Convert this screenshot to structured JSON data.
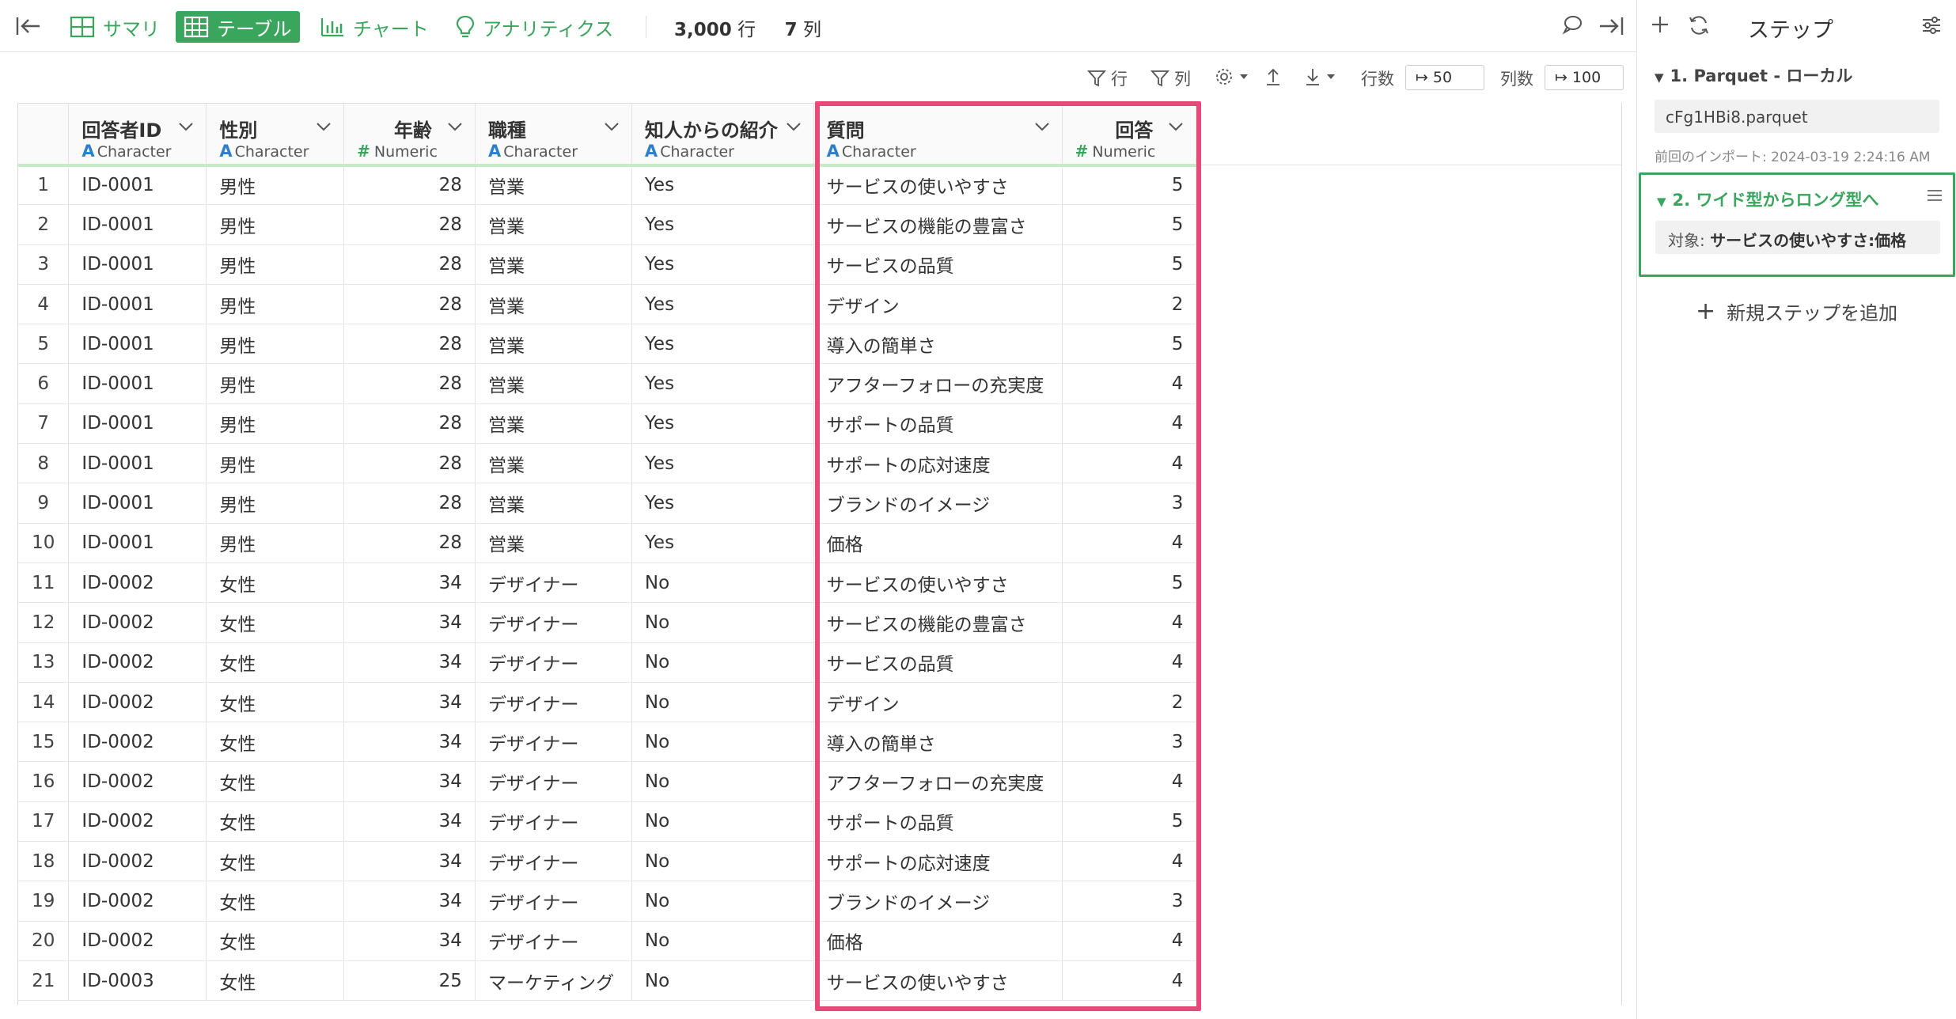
{
  "topbar": {
    "tabs": [
      {
        "label": "サマリ",
        "icon": "summary-grid-icon"
      },
      {
        "label": "テーブル",
        "icon": "table-icon"
      },
      {
        "label": "チャート",
        "icon": "bar-chart-icon"
      },
      {
        "label": "アナリティクス",
        "icon": "lightbulb-icon"
      }
    ],
    "active_tab": "テーブル",
    "rows_count": "3,000",
    "rows_unit": "行",
    "cols_count": "7",
    "cols_unit": "列"
  },
  "toolbar": {
    "filter_rows_label": "行",
    "filter_cols_label": "列",
    "row_count_label": "行数",
    "row_count_value": "50",
    "col_count_label": "列数",
    "col_count_value": "100"
  },
  "table": {
    "columns": [
      {
        "name": "回答者ID",
        "type": "Character"
      },
      {
        "name": "性別",
        "type": "Character"
      },
      {
        "name": "年齢",
        "type": "Numeric"
      },
      {
        "name": "職種",
        "type": "Character"
      },
      {
        "name": "知人からの紹介",
        "type": "Character"
      },
      {
        "name": "質問",
        "type": "Character"
      },
      {
        "name": "回答",
        "type": "Numeric"
      }
    ],
    "rows": [
      [
        "1",
        "ID-0001",
        "男性",
        "28",
        "営業",
        "Yes",
        "サービスの使いやすさ",
        "5"
      ],
      [
        "2",
        "ID-0001",
        "男性",
        "28",
        "営業",
        "Yes",
        "サービスの機能の豊富さ",
        "5"
      ],
      [
        "3",
        "ID-0001",
        "男性",
        "28",
        "営業",
        "Yes",
        "サービスの品質",
        "5"
      ],
      [
        "4",
        "ID-0001",
        "男性",
        "28",
        "営業",
        "Yes",
        "デザイン",
        "2"
      ],
      [
        "5",
        "ID-0001",
        "男性",
        "28",
        "営業",
        "Yes",
        "導入の簡単さ",
        "5"
      ],
      [
        "6",
        "ID-0001",
        "男性",
        "28",
        "営業",
        "Yes",
        "アフターフォローの充実度",
        "4"
      ],
      [
        "7",
        "ID-0001",
        "男性",
        "28",
        "営業",
        "Yes",
        "サポートの品質",
        "4"
      ],
      [
        "8",
        "ID-0001",
        "男性",
        "28",
        "営業",
        "Yes",
        "サポートの応対速度",
        "4"
      ],
      [
        "9",
        "ID-0001",
        "男性",
        "28",
        "営業",
        "Yes",
        "ブランドのイメージ",
        "3"
      ],
      [
        "10",
        "ID-0001",
        "男性",
        "28",
        "営業",
        "Yes",
        "価格",
        "4"
      ],
      [
        "11",
        "ID-0002",
        "女性",
        "34",
        "デザイナー",
        "No",
        "サービスの使いやすさ",
        "5"
      ],
      [
        "12",
        "ID-0002",
        "女性",
        "34",
        "デザイナー",
        "No",
        "サービスの機能の豊富さ",
        "4"
      ],
      [
        "13",
        "ID-0002",
        "女性",
        "34",
        "デザイナー",
        "No",
        "サービスの品質",
        "4"
      ],
      [
        "14",
        "ID-0002",
        "女性",
        "34",
        "デザイナー",
        "No",
        "デザイン",
        "2"
      ],
      [
        "15",
        "ID-0002",
        "女性",
        "34",
        "デザイナー",
        "No",
        "導入の簡単さ",
        "3"
      ],
      [
        "16",
        "ID-0002",
        "女性",
        "34",
        "デザイナー",
        "No",
        "アフターフォローの充実度",
        "4"
      ],
      [
        "17",
        "ID-0002",
        "女性",
        "34",
        "デザイナー",
        "No",
        "サポートの品質",
        "5"
      ],
      [
        "18",
        "ID-0002",
        "女性",
        "34",
        "デザイナー",
        "No",
        "サポートの応対速度",
        "4"
      ],
      [
        "19",
        "ID-0002",
        "女性",
        "34",
        "デザイナー",
        "No",
        "ブランドのイメージ",
        "3"
      ],
      [
        "20",
        "ID-0002",
        "女性",
        "34",
        "デザイナー",
        "No",
        "価格",
        "4"
      ],
      [
        "21",
        "ID-0003",
        "女性",
        "25",
        "マーケティング",
        "No",
        "サービスの使いやすさ",
        "4"
      ]
    ]
  },
  "steps_panel": {
    "title": "ステップ",
    "step1_title": "1. Parquet - ローカル",
    "step1_file": "cFg1HBi8.parquet",
    "step1_time": "前回のインポート: 2024-03-19 2:24:16 AM",
    "step2_title": "2. ワイド型からロング型へ",
    "step2_target_label": "対象:",
    "step2_target_value": "サービスの使いやすさ:価格",
    "add_step_label": "新規ステップを追加"
  },
  "colors": {
    "accent_green": "#3aa55c",
    "highlight_pink": "#e54a78",
    "character_type_blue": "#2d7fcb"
  }
}
